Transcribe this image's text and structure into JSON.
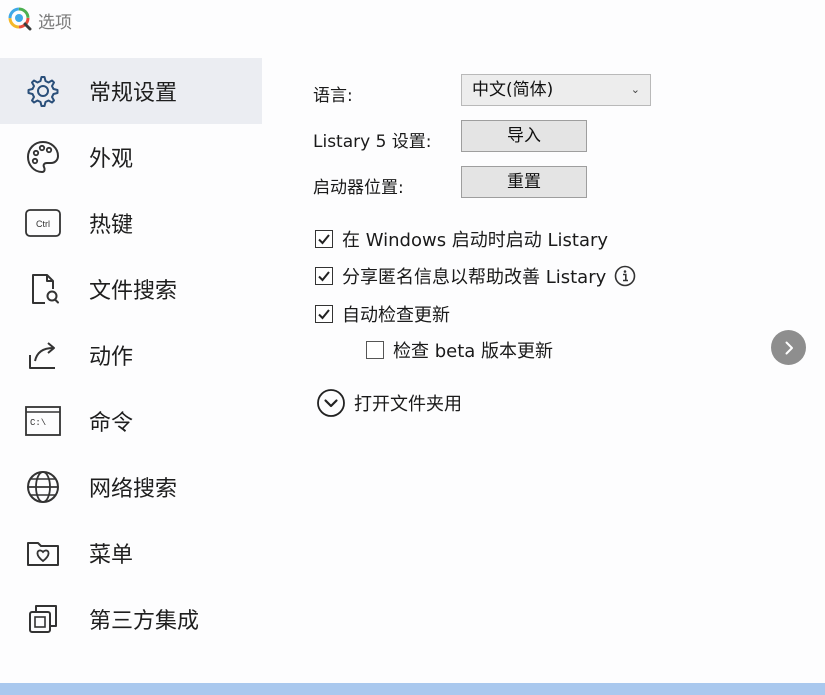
{
  "window": {
    "title": "选项"
  },
  "sidebar": {
    "items": [
      {
        "label": "常规设置",
        "icon": "gear-icon",
        "active": true
      },
      {
        "label": "外观",
        "icon": "palette-icon",
        "active": false
      },
      {
        "label": "热键",
        "icon": "ctrl-key-icon",
        "icon_text": "Ctrl",
        "active": false
      },
      {
        "label": "文件搜索",
        "icon": "file-search-icon",
        "active": false
      },
      {
        "label": "动作",
        "icon": "share-arrow-icon",
        "active": false
      },
      {
        "label": "命令",
        "icon": "command-prompt-icon",
        "icon_text": "C:\\",
        "active": false
      },
      {
        "label": "网络搜索",
        "icon": "globe-icon",
        "active": false
      },
      {
        "label": "菜单",
        "icon": "folder-heart-icon",
        "active": false
      },
      {
        "label": "第三方集成",
        "icon": "integration-icon",
        "active": false
      }
    ]
  },
  "general": {
    "language_label": "语言:",
    "language_value": "中文(简体)",
    "listary5_label": "Listary 5 设置:",
    "import_button": "导入",
    "launcher_label": "启动器位置:",
    "reset_button": "重置",
    "options": [
      {
        "label": "在 Windows 启动时启动 Listary",
        "checked": true
      },
      {
        "label": "分享匿名信息以帮助改善 Listary",
        "checked": true
      },
      {
        "label": "自动检查更新",
        "checked": true
      },
      {
        "label": "检查 beta 版本更新",
        "checked": false
      }
    ],
    "open_folder_label": "打开文件夹用"
  },
  "colors": {
    "active_item_bg": "#ebedf2",
    "bottom_bar": "#a9c8ee",
    "next_button": "#8e8e8e"
  }
}
